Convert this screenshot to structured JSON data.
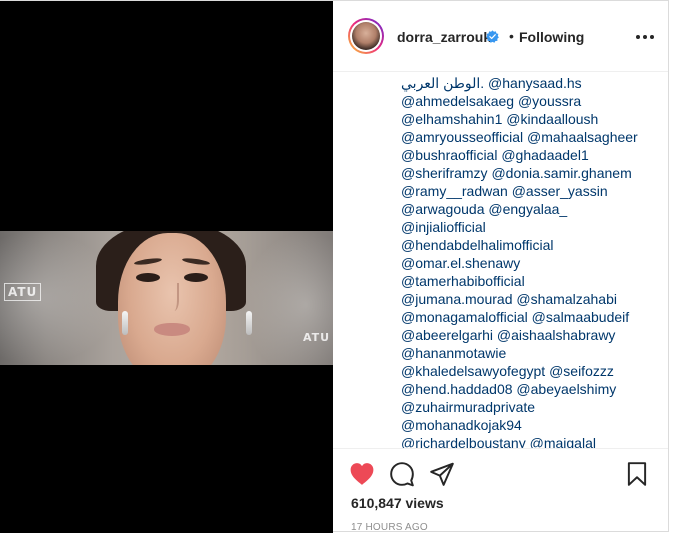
{
  "post": {
    "username": "dorra_zarrouk",
    "separator": "•",
    "follow_status": "Following",
    "caption_lines": [
      "الوطن العربي. @hanysaad.hs",
      "@ahmedelsakaeg @youssra",
      "@elhamshahin1 @kindaalloush",
      "@amryousseofficial @mahaalsagheer",
      "@bushraofficial @ghadaadel1",
      "@sheriframzy @donia.samir.ghanem",
      "@ramy__radwan @asser_yassin",
      "@arwagouda @engyalaa_",
      "@injialiofficial",
      "@hendabdelhalimofficial",
      "@omar.el.shenawy",
      "@tamerhabibofficial",
      "@jumana.mourad @shamalzahabi",
      "@monagamalofficial @salmaabudeif",
      "@abeerelgarhi @aishaalshabrawy",
      "@hananmotawie",
      "@khaledelsawyofegypt @seifozzz",
      "@hend.haddad08 @abeyaelshimy",
      "@zuhairmuradprivate",
      "@mohanadkojak94",
      "@richardelboustany @maigalal"
    ],
    "views": "610,847 views",
    "timestamp": "17 HOURS AGO"
  },
  "icons": {
    "like": "heart-icon",
    "comment": "comment-icon",
    "share": "share-icon",
    "save": "bookmark-icon",
    "more": "more-options-icon",
    "verified": "verified-badge-icon"
  },
  "colors": {
    "like": "#ed4956",
    "verified": "#3897f0",
    "link": "#00376b",
    "text": "#262626",
    "muted": "#8e8e8e"
  }
}
